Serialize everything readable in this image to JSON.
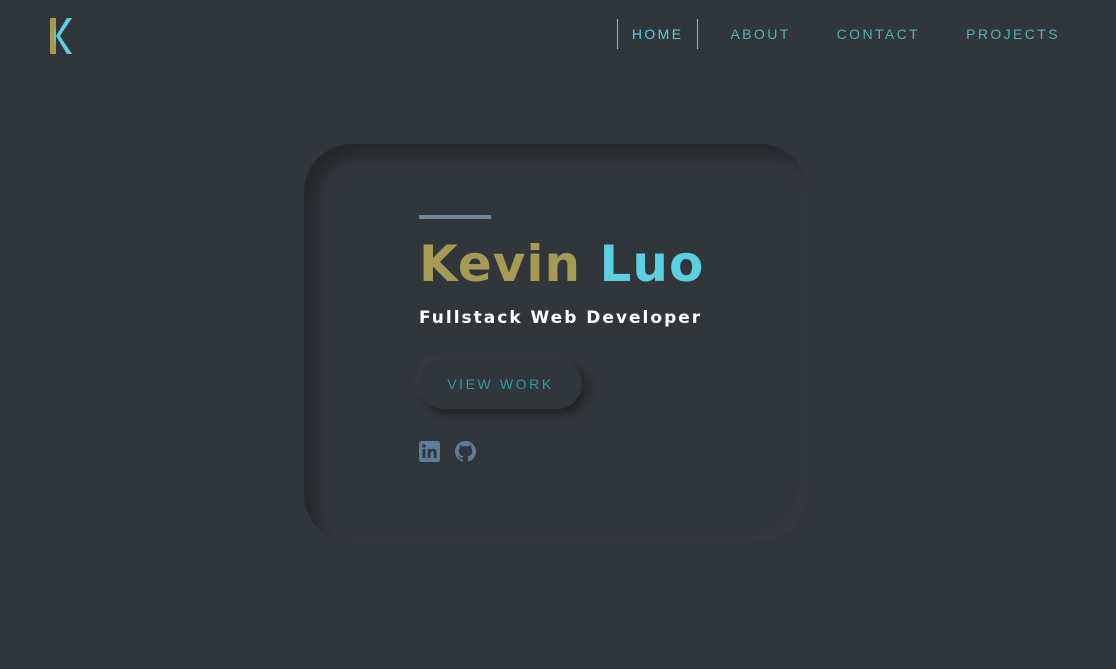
{
  "logo": {
    "letter": "K",
    "colors": {
      "left": "#a79a55",
      "right": "#5ccfe0"
    }
  },
  "nav": {
    "items": [
      {
        "label": "HOME",
        "active": true
      },
      {
        "label": "ABOUT",
        "active": false
      },
      {
        "label": "CONTACT",
        "active": false
      },
      {
        "label": "PROJECTS",
        "active": false
      }
    ]
  },
  "hero": {
    "first_name": "Kevin",
    "last_name": "Luo",
    "role": "Fullstack Web Developer",
    "cta_label": "VIEW WORK",
    "socials": [
      {
        "icon": "linkedin-icon"
      },
      {
        "icon": "github-icon"
      }
    ]
  },
  "colors": {
    "background": "#31363b",
    "accent_gold": "#a79a55",
    "accent_cyan": "#5ccfe0",
    "accent_line": "#6987a6",
    "social_icon": "#5d7c9c"
  }
}
